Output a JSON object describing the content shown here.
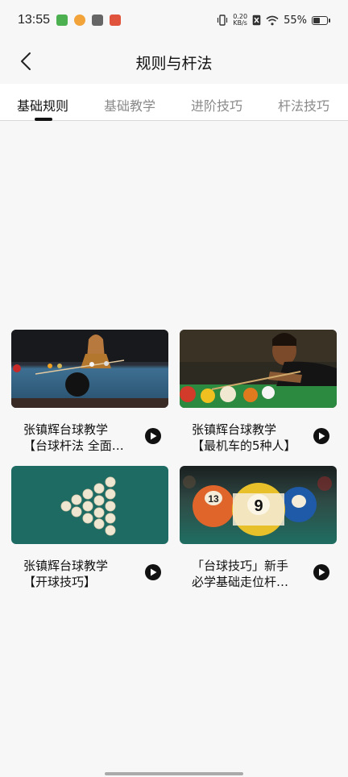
{
  "status": {
    "time": "13:55",
    "netspeed_value": "0.20",
    "netspeed_unit": "KB/s",
    "battery": "55%",
    "battery_level": 0.55
  },
  "header": {
    "title": "规则与杆法"
  },
  "tabs": [
    {
      "label": "基础规则",
      "active": true
    },
    {
      "label": "基础教学",
      "active": false
    },
    {
      "label": "进阶技巧",
      "active": false
    },
    {
      "label": "杆法技巧",
      "active": false
    }
  ],
  "videos": [
    {
      "line1": "张镇辉台球教学",
      "line2": "【台球杆法 全面…"
    },
    {
      "line1": "张镇辉台球教学",
      "line2": "【最机车的5种人】"
    },
    {
      "line1": "张镇辉台球教学",
      "line2": "【开球技巧】"
    },
    {
      "line1": "「台球技巧」新手",
      "line2": "必学基础走位杆…"
    }
  ],
  "thumbnail_balls": {
    "ball_13": "13",
    "ball_9": "9"
  },
  "colors": {
    "background": "#f7f7f7",
    "tab_active": "#111111",
    "tab_inactive": "#8a8a8a",
    "felt_blue": "#2c5c7a",
    "felt_teal": "#1e6b64",
    "felt_green": "#1f7a3a"
  }
}
